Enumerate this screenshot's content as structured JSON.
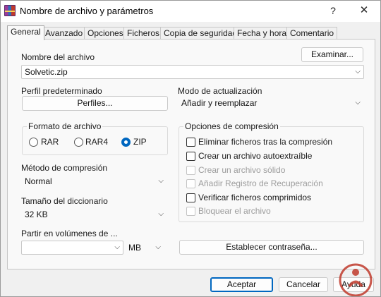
{
  "window": {
    "title": "Nombre de archivo y parámetros",
    "help_label": "?",
    "close_label": "✕"
  },
  "tabs": [
    {
      "label": "General"
    },
    {
      "label": "Avanzado"
    },
    {
      "label": "Opciones"
    },
    {
      "label": "Ficheros"
    },
    {
      "label": "Copia de seguridad"
    },
    {
      "label": "Fecha y hora"
    },
    {
      "label": "Comentario"
    }
  ],
  "archive_name": {
    "label": "Nombre del archivo",
    "value": "Solvetic.zip",
    "browse_label": "Examinar..."
  },
  "profile": {
    "label": "Perfil predeterminado",
    "button_label": "Perfiles..."
  },
  "update_mode": {
    "label": "Modo de actualización",
    "value": "Añadir y reemplazar"
  },
  "archive_format": {
    "title": "Formato de archivo",
    "options": [
      {
        "label": "RAR",
        "checked": false
      },
      {
        "label": "RAR4",
        "checked": false
      },
      {
        "label": "ZIP",
        "checked": true
      }
    ]
  },
  "compression_options": {
    "title": "Opciones de compresión",
    "items": [
      {
        "label": "Eliminar ficheros tras la compresión",
        "checked": false,
        "enabled": true
      },
      {
        "label": "Crear un archivo autoextraíble",
        "checked": false,
        "enabled": true
      },
      {
        "label": "Crear un archivo sólido",
        "checked": false,
        "enabled": false
      },
      {
        "label": "Añadir Registro de Recuperación",
        "checked": false,
        "enabled": false
      },
      {
        "label": "Verificar ficheros comprimidos",
        "checked": false,
        "enabled": true
      },
      {
        "label": "Bloquear el archivo",
        "checked": false,
        "enabled": false
      }
    ]
  },
  "compression_method": {
    "label": "Método de compresión",
    "value": "Normal"
  },
  "dictionary_size": {
    "label": "Tamaño del diccionario",
    "value": "32 KB"
  },
  "split_volumes": {
    "label": "Partir en volúmenes de ...",
    "value": "",
    "unit": "MB"
  },
  "password_button_label": "Establecer contraseña...",
  "footer": {
    "ok_label": "Aceptar",
    "cancel_label": "Cancelar",
    "help_label": "Ayuda"
  },
  "colors": {
    "accent": "#0067c0",
    "watermark": "#c0392b"
  }
}
